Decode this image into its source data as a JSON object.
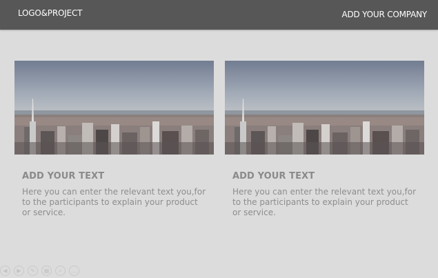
{
  "header": {
    "logo_text": "LOGO&PROJECT",
    "company_text": "ADD YOUR COMPANY"
  },
  "cards": [
    {
      "title": "ADD YOUR TEXT",
      "body": "Here you can enter the relevant text you,for to the participants to explain your product or service.",
      "image": "city-skyline-photo"
    },
    {
      "title": "ADD YOUR TEXT",
      "body": "Here you can enter the relevant text you,for to the participants to explain your product or service.",
      "image": "city-skyline-photo"
    }
  ],
  "slide_controls": [
    {
      "icon": "previous-icon"
    },
    {
      "icon": "next-icon"
    },
    {
      "icon": "pen-icon"
    },
    {
      "icon": "slides-icon"
    },
    {
      "icon": "zoom-icon"
    },
    {
      "icon": "more-icon"
    }
  ],
  "colors": {
    "header_bg": "#575757",
    "page_bg": "#dcdcdc",
    "text_gray": "#8a8a8a"
  }
}
